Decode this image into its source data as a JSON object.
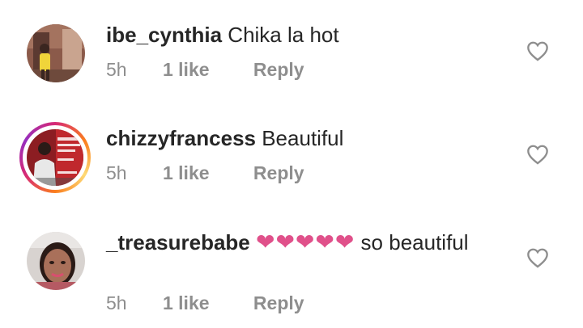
{
  "comments": [
    {
      "username": "ibe_cynthia",
      "text": "Chika la hot",
      "time": "5h",
      "likes": "1 like",
      "reply": "Reply",
      "avatar_icon": "avatar-photo",
      "has_story_ring": false
    },
    {
      "username": "chizzyfrancess",
      "text": "Beautiful",
      "time": "5h",
      "likes": "1 like",
      "reply": "Reply",
      "avatar_icon": "avatar-photo",
      "has_story_ring": true
    },
    {
      "username": "_treasurebabe",
      "emoji": "❤❤❤❤❤",
      "text": "so beautiful",
      "time": "5h",
      "likes": "1 like",
      "reply": "Reply",
      "avatar_icon": "avatar-photo",
      "has_story_ring": false
    }
  ],
  "colors": {
    "text": "#262626",
    "meta": "#8e8e8e",
    "heart_emoji": "#e0508a",
    "heart_outline": "#8e8e8e"
  },
  "icons": {
    "like": "heart-outline-icon"
  }
}
